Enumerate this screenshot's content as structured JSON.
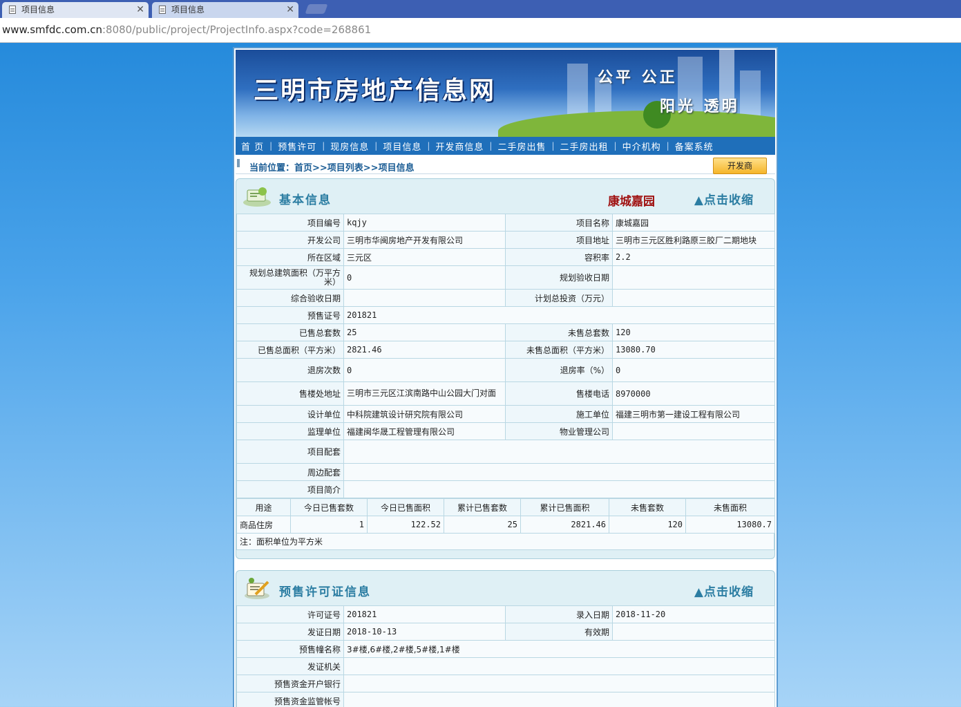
{
  "browser": {
    "tabs": [
      {
        "label": "项目信息",
        "active": true
      },
      {
        "label": "项目信息",
        "active": false
      }
    ],
    "url_domain": "www.smfdc.com.cn",
    "url_path": ":8080/public/project/ProjectInfo.aspx?code=268861"
  },
  "header": {
    "site_title": "三明市房地产信息网",
    "slogan_1": "公平  公正",
    "slogan_2": "阳光  透明"
  },
  "nav": {
    "items": [
      "首  页",
      "预售许可",
      "现房信息",
      "项目信息",
      "开发商信息",
      "二手房出售",
      "二手房出租",
      "中介机构",
      "备案系统"
    ],
    "separator": "|"
  },
  "breadcrumb": {
    "text": "当前位置：首页>>项目列表>>项目信息",
    "developer_button": "开发商"
  },
  "basic_info": {
    "title": "基本信息",
    "project_name_display": "康城嘉园",
    "collapse_label": "▲点击收缩",
    "rows": [
      {
        "l1": "项目编号",
        "v1": "kqjy",
        "l2": "项目名称",
        "v2": "康城嘉园"
      },
      {
        "l1": "开发公司",
        "v1": "三明市华闽房地产开发有限公司",
        "l2": "项目地址",
        "v2": "三明市三元区胜利路原三胶厂二期地块"
      },
      {
        "l1": "所在区域",
        "v1": "三元区",
        "l2": "容积率",
        "v2": "2.2"
      },
      {
        "l1": "规划总建筑面积（万平方米）",
        "v1": "0",
        "l2": "规划验收日期",
        "v2": ""
      },
      {
        "l1": "综合验收日期",
        "v1": "",
        "l2": "计划总投资（万元）",
        "v2": ""
      },
      {
        "l1": "预售证号",
        "v1": "201821"
      },
      {
        "l1": "已售总套数",
        "v1": "25",
        "l2": "未售总套数",
        "v2": "120"
      },
      {
        "l1": "已售总面积（平方米）",
        "v1": "2821.46",
        "l2": "未售总面积（平方米）",
        "v2": "13080.70"
      },
      {
        "l1": "退房次数",
        "v1": "0",
        "l2": "退房率（%）",
        "v2": "0"
      },
      {
        "l1": "售楼处地址",
        "v1": "三明市三元区江滨南路中山公园大门对面",
        "l2": "售楼电话",
        "v2": "8970000"
      },
      {
        "l1": "设计单位",
        "v1": "中科院建筑设计研究院有限公司",
        "l2": "施工单位",
        "v2": "福建三明市第一建设工程有限公司"
      },
      {
        "l1": "监理单位",
        "v1": "福建闽华晟工程管理有限公司",
        "l2": "物业管理公司",
        "v2": ""
      },
      {
        "l1": "项目配套",
        "v1": ""
      },
      {
        "l1": "周边配套",
        "v1": ""
      },
      {
        "l1": "项目简介",
        "v1": ""
      }
    ],
    "stats_headers": [
      "用途",
      "今日已售套数",
      "今日已售面积",
      "累计已售套数",
      "累计已售面积",
      "未售套数",
      "未售面积"
    ],
    "stats_rows": [
      [
        "商品住房",
        "1",
        "122.52",
        "25",
        "2821.46",
        "120",
        "13080.7"
      ]
    ],
    "note": "注：面积单位为平方米"
  },
  "presale_info": {
    "title": "预售许可证信息",
    "collapse_label": "▲点击收缩",
    "rows": [
      {
        "l1": "许可证号",
        "v1": "201821",
        "l2": "录入日期",
        "v2": "2018-11-20"
      },
      {
        "l1": "发证日期",
        "v1": "2018-10-13",
        "l2": "有效期",
        "v2": ""
      },
      {
        "l1": "预售幢名称",
        "v1": "3#楼,6#楼,2#楼,5#楼,1#楼"
      },
      {
        "l1": "发证机关",
        "v1": ""
      },
      {
        "l1": "预售资金开户银行",
        "v1": ""
      },
      {
        "l1": "预售资金监管帐号",
        "v1": ""
      }
    ]
  }
}
